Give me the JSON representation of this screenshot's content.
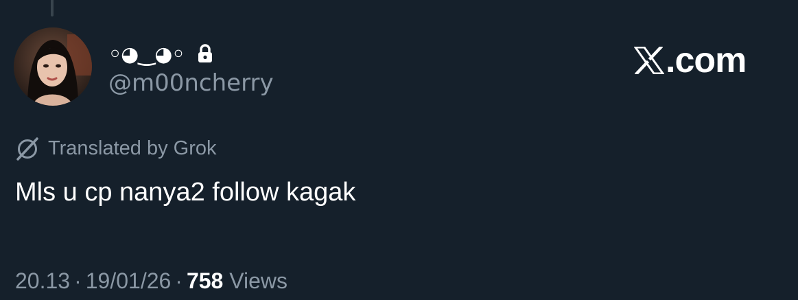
{
  "author": {
    "display_name": "◦◕‿◕◦",
    "handle": "@m00ncherry",
    "protected": true
  },
  "brand": {
    "logo_text": ".com",
    "icon": "x-logo-icon"
  },
  "translation": {
    "label": "Translated by Grok",
    "icon": "grok-icon"
  },
  "tweet": {
    "text": "Mls u cp nanya2 follow kagak"
  },
  "meta": {
    "time": "20.13",
    "separator": "·",
    "date": "19/01/26",
    "views_count": "758",
    "views_label": "Views"
  },
  "colors": {
    "background": "#15202b",
    "primary_text": "#ffffff",
    "secondary_text": "#8b98a5",
    "thread_line": "#38444d"
  }
}
